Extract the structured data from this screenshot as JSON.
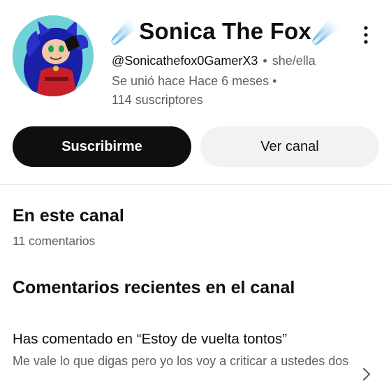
{
  "channel": {
    "name": "☄️Sonica The Fox☄️",
    "handle": "@Sonicathefox0GamerX3",
    "separator": "•",
    "pronouns": "she/ella",
    "joined": "Se unió hace Hace 6 meses •",
    "subscribers": "114 suscriptores",
    "avatar_icon": "avatar-image",
    "accent_bg": "#6fd3d6"
  },
  "actions": {
    "subscribe_label": "Suscribirme",
    "view_channel_label": "Ver canal"
  },
  "about_section": {
    "title": "En este canal",
    "comments_count": "11 comentarios"
  },
  "recent_section": {
    "title": "Comentarios recientes en el canal",
    "comments": [
      {
        "title": "Has comentado en “Estoy de vuelta tontos”",
        "body": "Me vale lo que digas pero yo los voy a criticar a ustedes dos"
      }
    ]
  },
  "icons": {
    "more": "more-vertical-icon",
    "chevron": "chevron-right-icon"
  }
}
